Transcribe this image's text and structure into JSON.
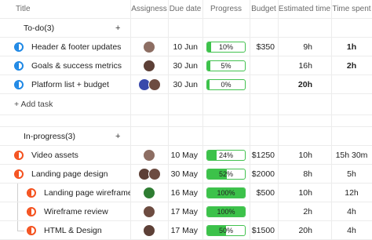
{
  "columns": {
    "title": "Title",
    "assignees": "Assigness",
    "due_date": "Due date",
    "progress": "Progress",
    "budget": "Budget",
    "estimated_time": "Estimated time",
    "time_spent": "Time spent"
  },
  "groups": [
    {
      "label": "To-do(3)",
      "add_icon": "+",
      "tasks": [
        {
          "title": "Header & footer updates",
          "status_color": "#1e88e5",
          "due": "10 Jun",
          "progress": "10%",
          "progress_value": 10,
          "budget": "$350",
          "estimated": "9h",
          "spent": "1h"
        },
        {
          "title": "Goals & success metrics",
          "status_color": "#1e88e5",
          "due": "30 Jun",
          "progress": "5%",
          "progress_value": 5,
          "budget": "",
          "estimated": "16h",
          "spent": "2h"
        },
        {
          "title": "Platform list + budget",
          "status_color": "#1e88e5",
          "due": "30 Jun",
          "progress": "0%",
          "progress_value": 0,
          "budget": "",
          "estimated": "20h",
          "spent": ""
        }
      ],
      "add_task_label": "+ Add task"
    },
    {
      "label": "In-progress(3)",
      "add_icon": "+",
      "tasks": [
        {
          "title": "Video assets",
          "status_color": "#f4511e",
          "due": "10 May",
          "progress": "24%",
          "progress_value": 24,
          "budget": "$1250",
          "estimated": "10h",
          "spent": "15h 30m"
        },
        {
          "title": "Landing page design",
          "status_color": "#f4511e",
          "due": "30 May",
          "progress": "52%",
          "progress_value": 52,
          "budget": "$2000",
          "estimated": "8h",
          "spent": "5h"
        },
        {
          "title": "Landing page wireframe",
          "status_color": "#f4511e",
          "due": "16 May",
          "progress": "100%",
          "progress_value": 100,
          "budget": "$500",
          "estimated": "10h",
          "spent": "12h"
        },
        {
          "title": "Wireframe review",
          "status_color": "#f4511e",
          "due": "17 May",
          "progress": "100%",
          "progress_value": 100,
          "budget": "",
          "estimated": "2h",
          "spent": "4h"
        },
        {
          "title": "HTML & Design",
          "status_color": "#f4511e",
          "due": "17 May",
          "progress": "50%",
          "progress_value": 50,
          "budget": "$1500",
          "estimated": "20h",
          "spent": "4h"
        }
      ]
    }
  ]
}
